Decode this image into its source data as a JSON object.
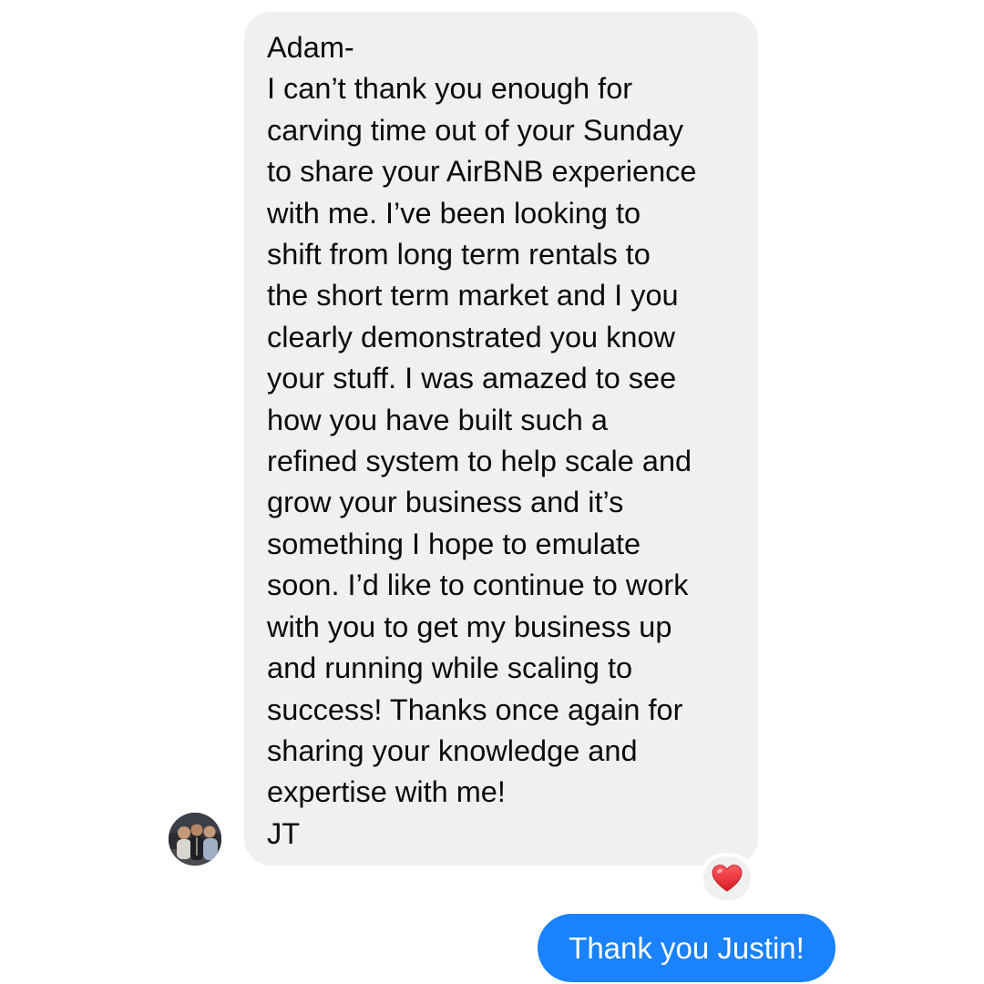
{
  "thread": {
    "incoming_message": {
      "lines": [
        "Adam-",
        "I can’t thank you enough for",
        "carving time out of your Sunday",
        "to share your AirBNB experience",
        "with me. I’ve been looking to",
        "shift from long term rentals to",
        "the short term market and I you",
        "clearly demonstrated you know",
        "your stuff. I was amazed to see",
        "how you have built such a",
        "refined system to help scale and",
        "grow your business and it’s",
        "something I hope to emulate",
        "soon. I’d like to continue to work",
        "with you to get my business up",
        "and running while scaling to",
        "success! Thanks once again for",
        "sharing your knowledge and",
        "expertise with me!",
        "JT"
      ],
      "bubble_color": "#f0f0f0",
      "text_color": "#0b0b0b"
    },
    "sender_avatar": "avatar-photo",
    "reaction": {
      "icon": "heart-icon",
      "color": "#e0242e"
    },
    "outgoing_message": {
      "text": "Thank you Justin!",
      "bubble_color": "#1982fc",
      "text_color": "#ffffff"
    }
  }
}
